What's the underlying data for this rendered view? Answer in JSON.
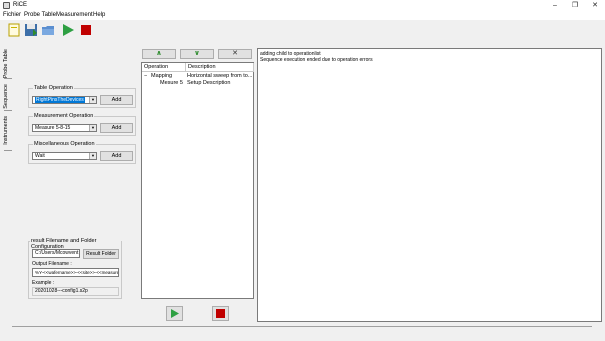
{
  "window": {
    "title": "RiCE",
    "minimize": "–",
    "restore": "❐",
    "close": "✕"
  },
  "menu": {
    "items": [
      "Fichier",
      "Probe Table",
      "Measurement",
      "Help"
    ]
  },
  "toolbar": {
    "icons": [
      "new-file-icon",
      "save-icon",
      "open-folder-icon",
      "run-icon",
      "stop-icon"
    ]
  },
  "sidetabs": {
    "probe_table": "Probe Table",
    "sequence": "Sequence",
    "instruments": "Instruments"
  },
  "table_operation": {
    "title": "Table Operation",
    "selected": "RightPinsTheDevices",
    "add": "Add"
  },
  "measurement_operation": {
    "title": "Measurement Operation",
    "selected": "Measure 5-8-15",
    "add": "Add"
  },
  "misc_operation": {
    "title": "Miscellaneous Operation",
    "selected": "Wait",
    "add": "Add"
  },
  "result": {
    "title": "result Filename and Folder Configuration",
    "folder_value": "C:/Users/Mcowvent",
    "folder_button": "Result Folder",
    "output_label": "Output Filename :",
    "output_value": "%Y-<<wafername>>-<<site>>-<<measure>>",
    "example_label": "Example :",
    "example_value": "20201028---config1.s2p"
  },
  "sequence": {
    "up_label": "∧",
    "down_label": "∨",
    "delete_label": "✕",
    "columns": [
      "Operation",
      "Description"
    ],
    "rows": [
      {
        "expander": "−",
        "operation": "Mapping",
        "description": "Horizontal sweep from to..."
      },
      {
        "expander": "",
        "operation": "Mesure 5",
        "description": "Setup Description"
      }
    ]
  },
  "log": {
    "lines": [
      "adding child to operationlist",
      "Sequence execution ended due to operation errors"
    ]
  },
  "colors": {
    "run": "#2ea043",
    "stop": "#c00000",
    "highlight": "#0078d7"
  }
}
